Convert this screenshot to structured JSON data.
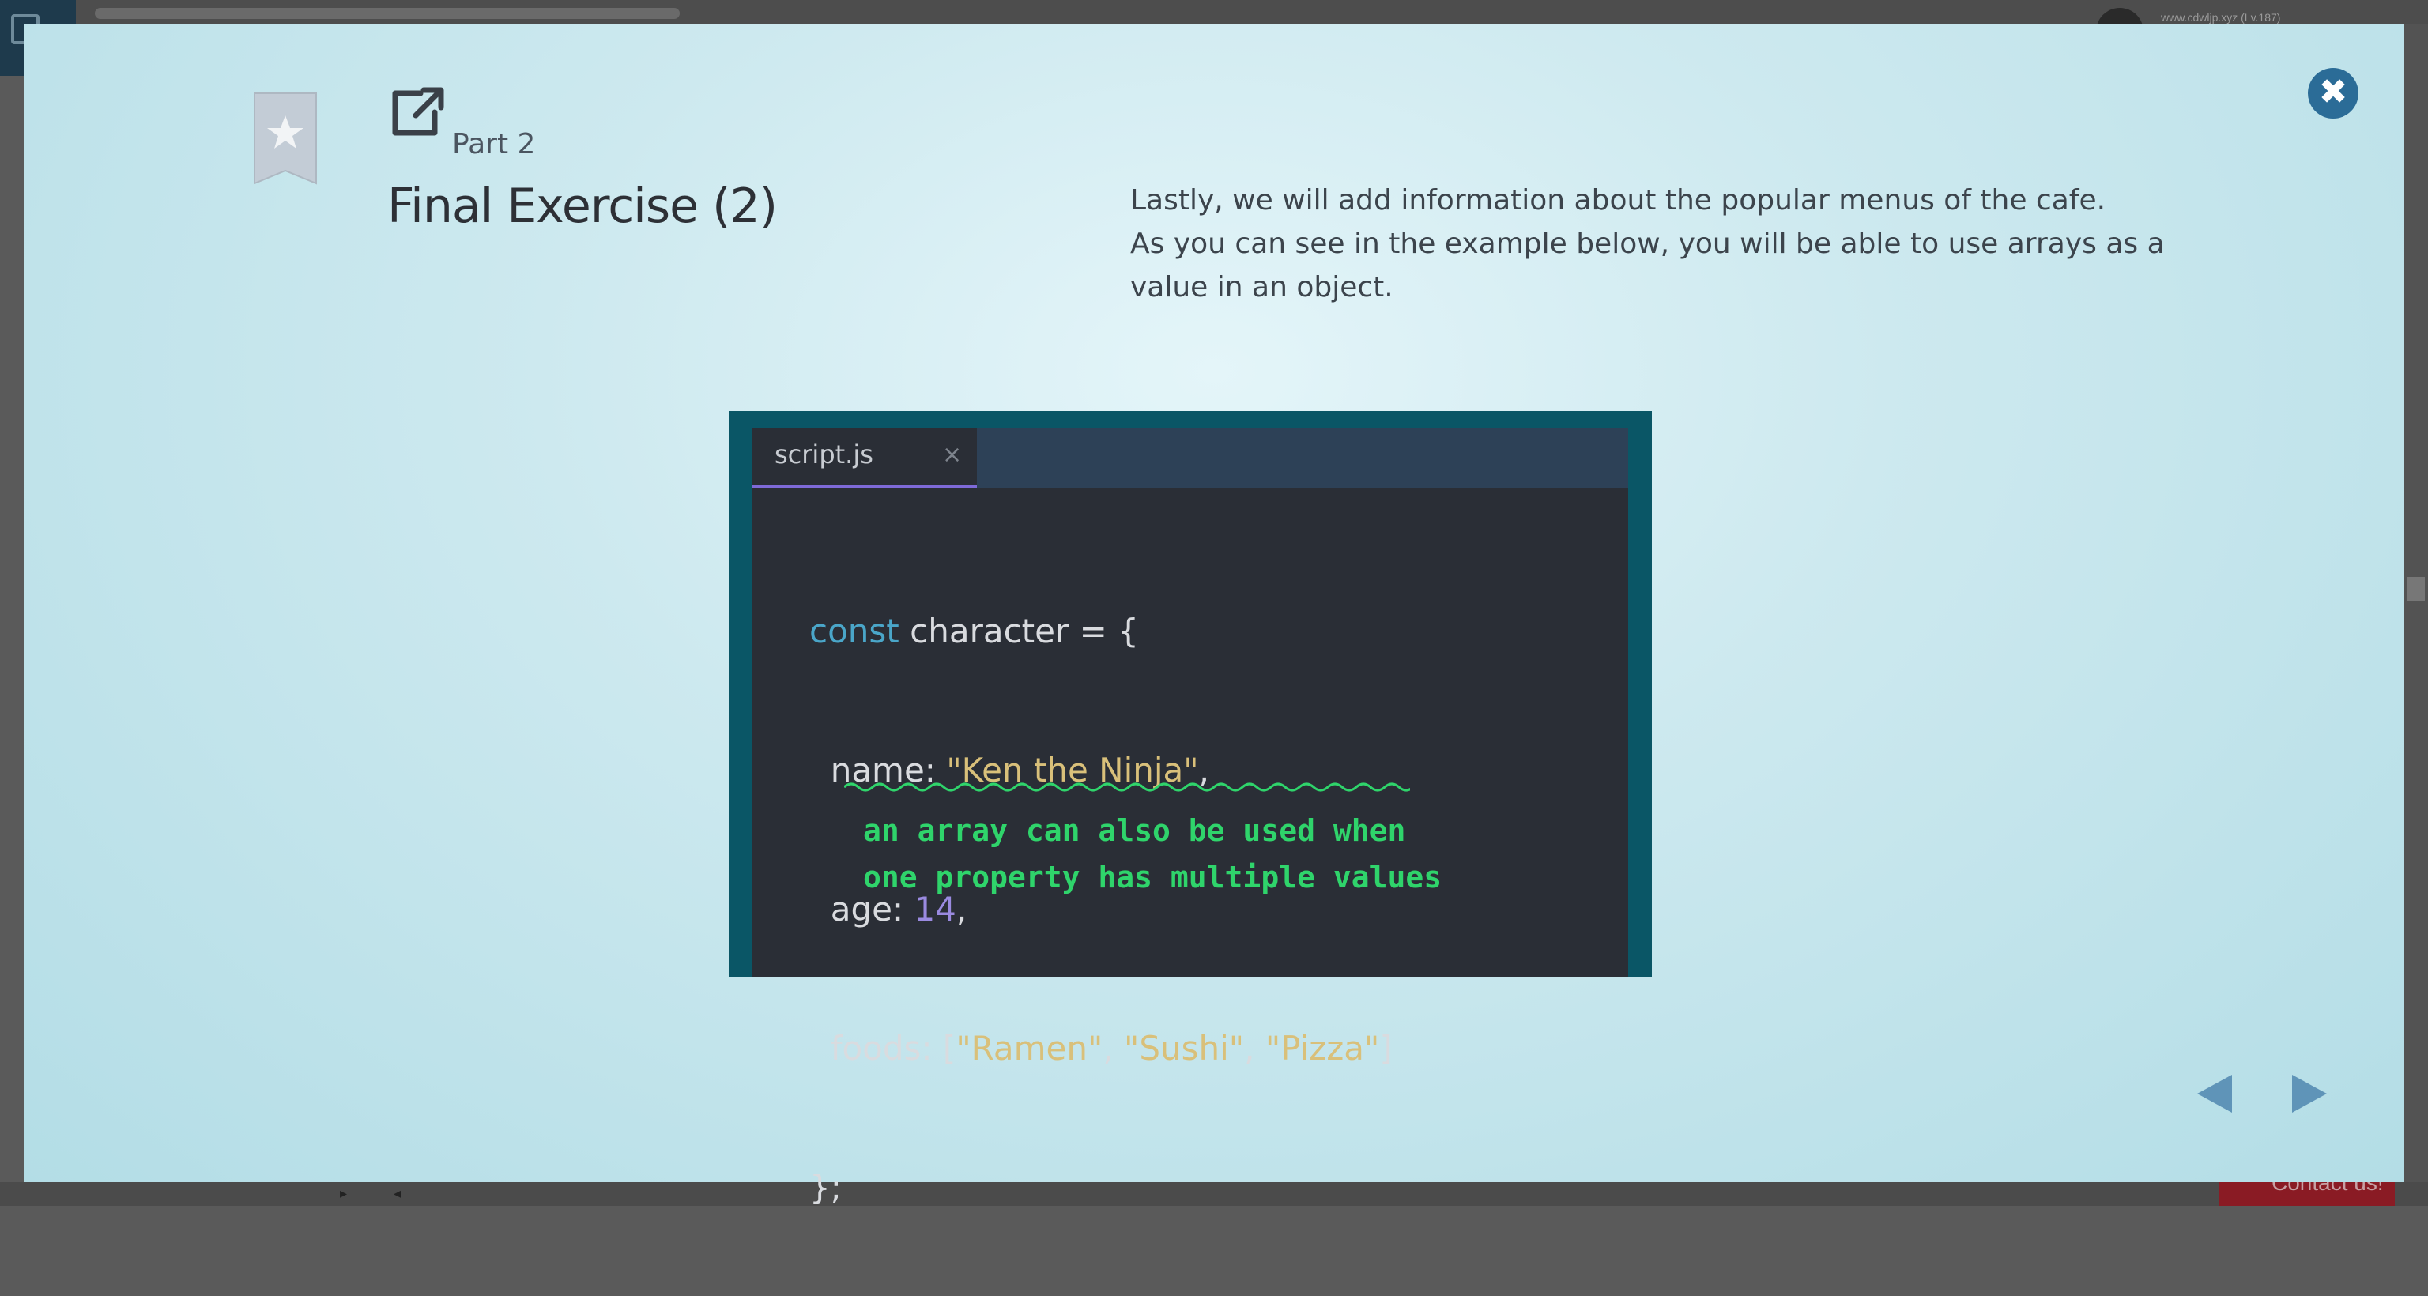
{
  "background": {
    "user_text": "www.cdwljp.xyz (Lv.187)",
    "contact_label": "Contact us!"
  },
  "modal": {
    "part_label": "Part 2",
    "title": "Final Exercise (2)",
    "description_lines": [
      "Lastly, we will add information about the popular menus of the cafe.",
      "As you can see in the example below, you will be able to use arrays as a",
      "value in an object."
    ],
    "close_icon": "close-icon",
    "bookmark_icon": "star-bookmark-icon",
    "external_link_icon": "external-link-icon"
  },
  "editor": {
    "tab_name": "script.js",
    "tab_close": "×",
    "code": {
      "l1_kw": "const",
      "l1_rest": " character = {",
      "l2_key": "  name: ",
      "l2_str": "\"Ken the Ninja\"",
      "l2_end": ",",
      "l3_key": "  age: ",
      "l3_num": "14",
      "l3_end": ",",
      "l4_key": "  foods: [",
      "l4_s1": "\"Ramen\"",
      "l4_c1": ", ",
      "l4_s2": "\"Sushi\"",
      "l4_c2": ", ",
      "l4_s3": "\"Pizza\"",
      "l4_end": "]",
      "l5": "};"
    },
    "annotation": [
      "an array can also be used when",
      "one property has multiple values"
    ]
  },
  "nav": {
    "prev_icon": "previous-arrow-icon",
    "next_icon": "next-arrow-icon"
  }
}
